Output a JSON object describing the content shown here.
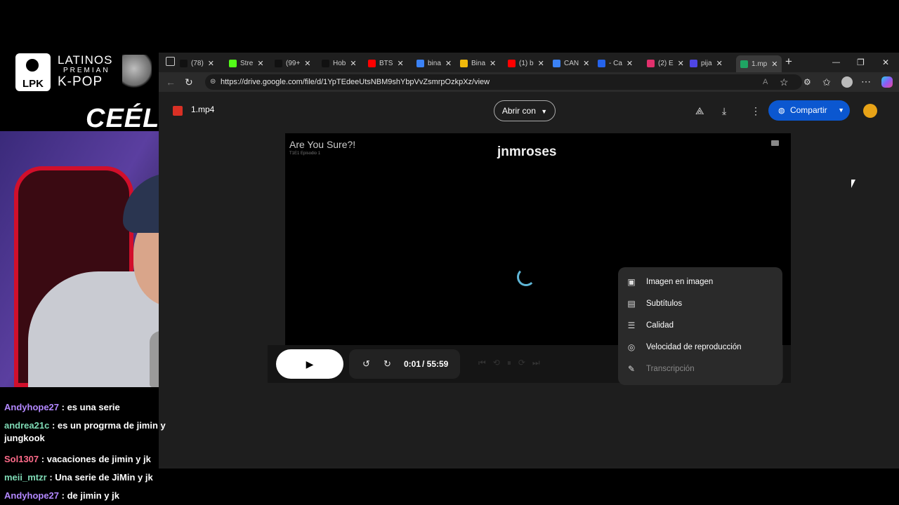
{
  "overlay": {
    "logo_line1": "LATINOS",
    "logo_line2": "PREMIAN",
    "logo_line3": "K-POP",
    "logo_badge": "LPK",
    "streamer_tag": "CEÉLE"
  },
  "browser": {
    "tabs": [
      {
        "label": "(78)",
        "favicon": "tiktok-icon",
        "color": "#111111"
      },
      {
        "label": "Stre",
        "favicon": "kick-icon",
        "color": "#53fc18"
      },
      {
        "label": "(99+",
        "favicon": "tiktok-icon",
        "color": "#111111"
      },
      {
        "label": "Hob",
        "favicon": "tiktok-icon",
        "color": "#111111"
      },
      {
        "label": "BTS",
        "favicon": "youtube-icon",
        "color": "#ff0000"
      },
      {
        "label": "bina",
        "favicon": "search-icon",
        "color": "#3b82f6"
      },
      {
        "label": "Bina",
        "favicon": "binance-icon",
        "color": "#f0b90b"
      },
      {
        "label": "(1) b",
        "favicon": "youtube-icon",
        "color": "#ff0000"
      },
      {
        "label": "CAN",
        "favicon": "search-icon",
        "color": "#3b82f6"
      },
      {
        "label": "- Ca",
        "favicon": "c-icon",
        "color": "#2563eb"
      },
      {
        "label": "(2) E",
        "favicon": "instagram-icon",
        "color": "#e1306c"
      },
      {
        "label": "pija",
        "favicon": "app-icon",
        "color": "#4f46e5"
      },
      {
        "label": "1.mp",
        "favicon": "drive-icon",
        "color": "#1fa463"
      }
    ],
    "new_tab": "+",
    "window_controls": {
      "minimize": "—",
      "restore": "❐",
      "close": "✕"
    },
    "url": "https://drive.google.com/file/d/1YpTEdeeUtsNBM9shYbpVvZsmrpOzkpXz/view"
  },
  "drive": {
    "file_name": "1.mp4",
    "open_with": "Abrir con",
    "share": "Compartir"
  },
  "video": {
    "title": "Are You Sure?!",
    "subtitle": "T1E1 Episodio 1",
    "watermark": "jnmroses",
    "current_time": "0:01",
    "duration": "/ 55:59",
    "speed": "1x",
    "progress_fraction": 0.0003
  },
  "settings_menu": {
    "items": [
      {
        "label": "Imagen en imagen",
        "icon": "picture-in-picture-icon",
        "enabled": true
      },
      {
        "label": "Subtítulos",
        "icon": "captions-icon",
        "enabled": true
      },
      {
        "label": "Calidad",
        "icon": "tune-icon",
        "enabled": true
      },
      {
        "label": "Velocidad de reproducción",
        "icon": "playback-speed-icon",
        "enabled": true
      },
      {
        "label": "Transcripción",
        "icon": "transcript-icon",
        "enabled": false
      }
    ]
  },
  "chat": {
    "messages": [
      {
        "user": "Andyhope27",
        "color": "#b388ff",
        "text": ": es una serie"
      },
      {
        "user": "andrea21c",
        "color": "#7fdbb6",
        "text": ": es un progrma de jimin y jungkook"
      },
      {
        "user": "Sol1307",
        "color": "#ff6b8a",
        "text": ": vacaciones de jimin y jk"
      },
      {
        "user": "meii_mtzr",
        "color": "#7fdbb6",
        "text": ": Una serie de JiMin y jk"
      },
      {
        "user": "Andyhope27",
        "color": "#b388ff",
        "text": ": de jimin y jk"
      }
    ]
  }
}
